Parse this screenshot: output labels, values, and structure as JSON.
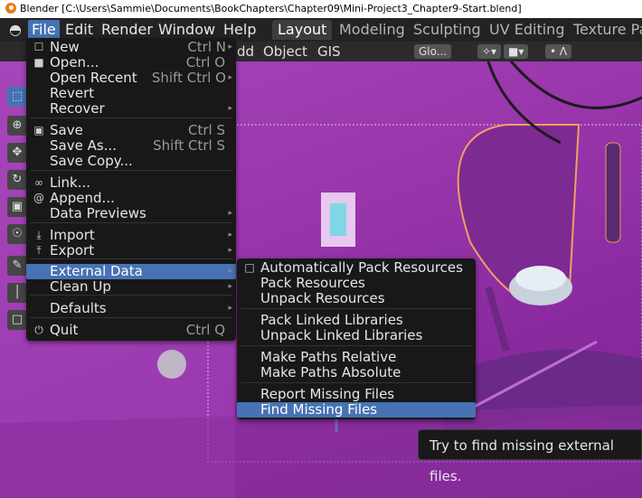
{
  "window": {
    "title": "Blender [C:\\Users\\Sammie\\Documents\\BookChapters\\Chapter09\\Mini-Project3_Chapter9-Start.blend]"
  },
  "topbar": {
    "menus": [
      "File",
      "Edit",
      "Render",
      "Window",
      "Help"
    ],
    "workspaces": [
      "Layout",
      "Modeling",
      "Sculpting",
      "UV Editing",
      "Texture Pa"
    ]
  },
  "header": {
    "items": [
      "dd",
      "Object",
      "GIS"
    ],
    "orientation": "Glo..."
  },
  "file_menu": {
    "items": [
      {
        "icon": "new-icon",
        "label": "New",
        "shortcut": "Ctrl N",
        "submenu": true
      },
      {
        "icon": "folder-icon",
        "label": "Open...",
        "shortcut": "Ctrl O",
        "submenu": false
      },
      {
        "icon": "",
        "label": "Open Recent",
        "shortcut": "Shift Ctrl O",
        "submenu": true
      },
      {
        "icon": "",
        "label": "Revert",
        "shortcut": "",
        "submenu": false
      },
      {
        "icon": "",
        "label": "Recover",
        "shortcut": "",
        "submenu": true
      },
      {
        "icon": "save-icon",
        "label": "Save",
        "shortcut": "Ctrl S",
        "submenu": false
      },
      {
        "icon": "",
        "label": "Save As...",
        "shortcut": "Shift Ctrl S",
        "submenu": false
      },
      {
        "icon": "",
        "label": "Save Copy...",
        "shortcut": "",
        "submenu": false
      },
      {
        "icon": "link-icon",
        "label": "Link...",
        "shortcut": "",
        "submenu": false
      },
      {
        "icon": "append-icon",
        "label": "Append...",
        "shortcut": "",
        "submenu": false
      },
      {
        "icon": "",
        "label": "Data Previews",
        "shortcut": "",
        "submenu": true
      },
      {
        "icon": "import-icon",
        "label": "Import",
        "shortcut": "",
        "submenu": true
      },
      {
        "icon": "export-icon",
        "label": "Export",
        "shortcut": "",
        "submenu": true
      },
      {
        "icon": "",
        "label": "External Data",
        "shortcut": "",
        "submenu": true
      },
      {
        "icon": "",
        "label": "Clean Up",
        "shortcut": "",
        "submenu": true
      },
      {
        "icon": "",
        "label": "Defaults",
        "shortcut": "",
        "submenu": true
      },
      {
        "icon": "power-icon",
        "label": "Quit",
        "shortcut": "Ctrl Q",
        "submenu": false
      }
    ]
  },
  "external_data_menu": {
    "items": [
      {
        "label": "Automatically Pack Resources",
        "checkbox": true
      },
      {
        "label": "Pack Resources",
        "checkbox": false
      },
      {
        "label": "Unpack Resources",
        "checkbox": false
      },
      {
        "label": "Pack Linked Libraries",
        "checkbox": false
      },
      {
        "label": "Unpack Linked Libraries",
        "checkbox": false
      },
      {
        "label": "Make Paths Relative",
        "checkbox": false
      },
      {
        "label": "Make Paths Absolute",
        "checkbox": false
      },
      {
        "label": "Report Missing Files",
        "checkbox": false
      },
      {
        "label": "Find Missing Files",
        "checkbox": false
      }
    ]
  },
  "tooltip": "Try to find missing external files.",
  "colors": {
    "accent": "#4772b3",
    "menu_bg": "#181818",
    "viewport": "#9b37ad"
  }
}
